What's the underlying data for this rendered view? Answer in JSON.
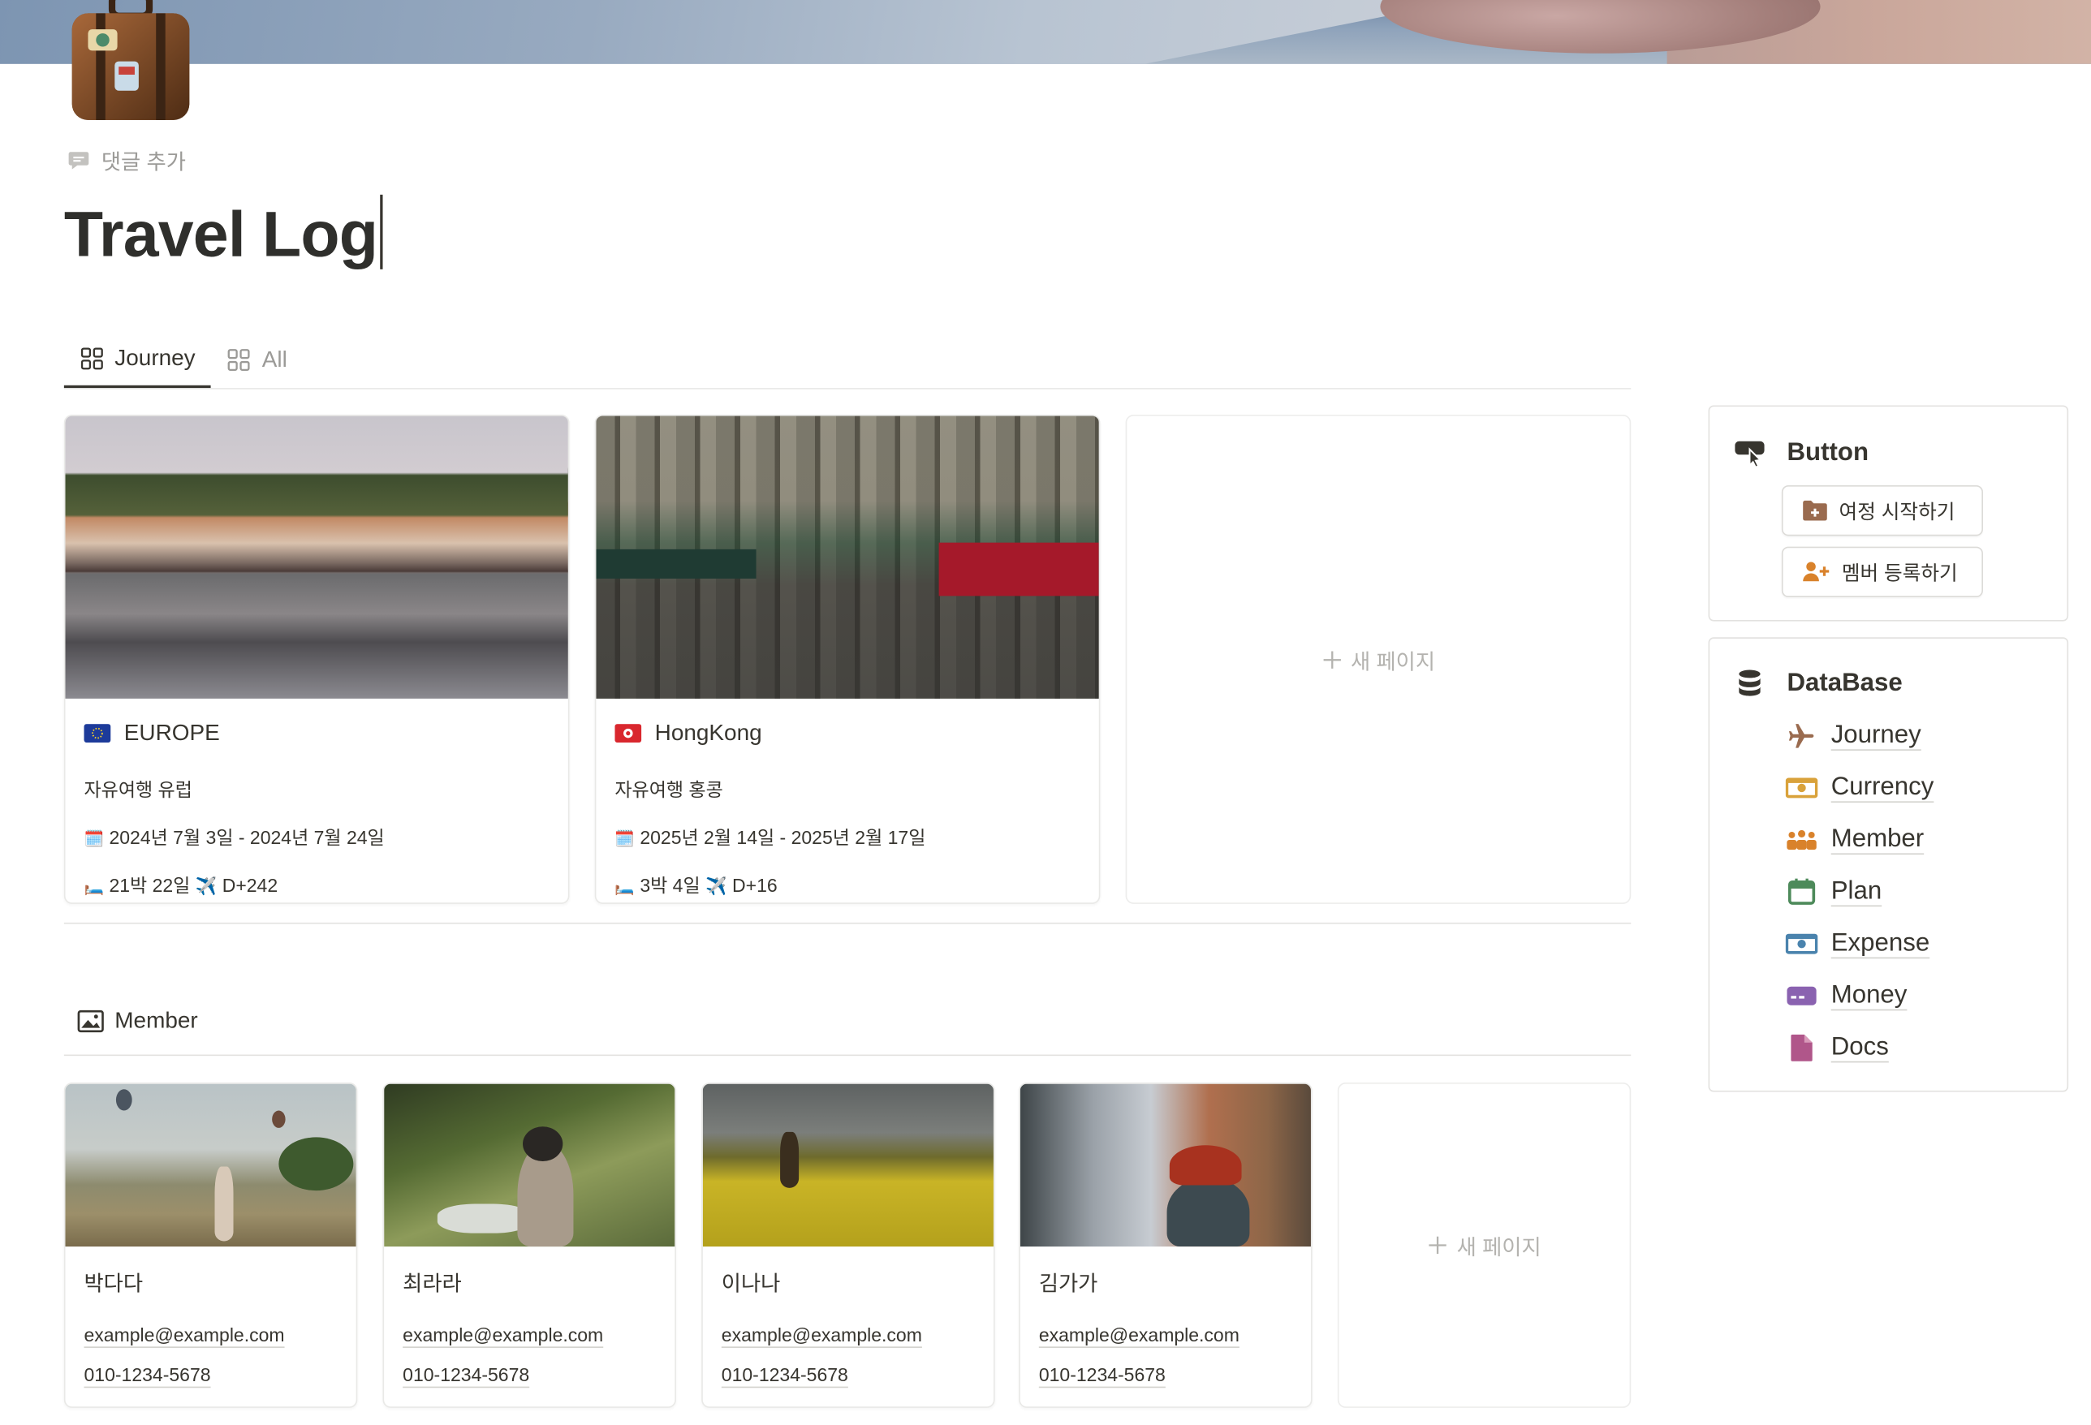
{
  "page": {
    "title": "Travel Log",
    "comment_label": "댓글 추가"
  },
  "tabs": [
    {
      "label": "Journey",
      "active": true
    },
    {
      "label": "All",
      "active": false
    }
  ],
  "journeys": [
    {
      "flag": "eu",
      "name": "EUROPE",
      "desc": "자유여행 유럽",
      "dates_icon": "🗓️",
      "dates": "2024년 7월 3일 - 2024년 7월 24일",
      "stay_icon": "🛏️",
      "stay": "21박 22일",
      "plane_icon": "✈️",
      "dday": "D+242"
    },
    {
      "flag": "hk",
      "name": "HongKong",
      "desc": "자유여행 홍콩",
      "dates_icon": "🗓️",
      "dates": "2025년 2월 14일 - 2025년 2월 17일",
      "stay_icon": "🛏️",
      "stay": "3박 4일",
      "plane_icon": "✈️",
      "dday": "D+16"
    }
  ],
  "new_page_label": "새 페이지",
  "member_section": {
    "title": "Member",
    "members": [
      {
        "name": "박다다",
        "email": "example@example.com",
        "phone": "010-1234-5678"
      },
      {
        "name": "최라라",
        "email": "example@example.com",
        "phone": "010-1234-5678"
      },
      {
        "name": "이나나",
        "email": "example@example.com",
        "phone": "010-1234-5678"
      },
      {
        "name": "김가가",
        "email": "example@example.com",
        "phone": "010-1234-5678"
      }
    ]
  },
  "button_panel": {
    "title": "Button",
    "buttons": [
      {
        "label": "여정 시작하기",
        "icon": "folder-plus-icon",
        "color": "#9a6b4f"
      },
      {
        "label": "멤버 등록하기",
        "icon": "person-add-icon",
        "color": "#d9822b"
      }
    ]
  },
  "database_panel": {
    "title": "DataBase",
    "items": [
      {
        "label": "Journey",
        "icon": "airplane-icon",
        "color": "#9a6b4f"
      },
      {
        "label": "Currency",
        "icon": "cash-icon",
        "color": "#d9a23b"
      },
      {
        "label": "Member",
        "icon": "group-icon",
        "color": "#d9822b"
      },
      {
        "label": "Plan",
        "icon": "calendar-icon",
        "color": "#4d8a5a"
      },
      {
        "label": "Expense",
        "icon": "cash-icon",
        "color": "#4a83ad"
      },
      {
        "label": "Money",
        "icon": "card-icon",
        "color": "#8a62b0"
      },
      {
        "label": "Docs",
        "icon": "document-icon",
        "color": "#b0568a"
      }
    ]
  }
}
